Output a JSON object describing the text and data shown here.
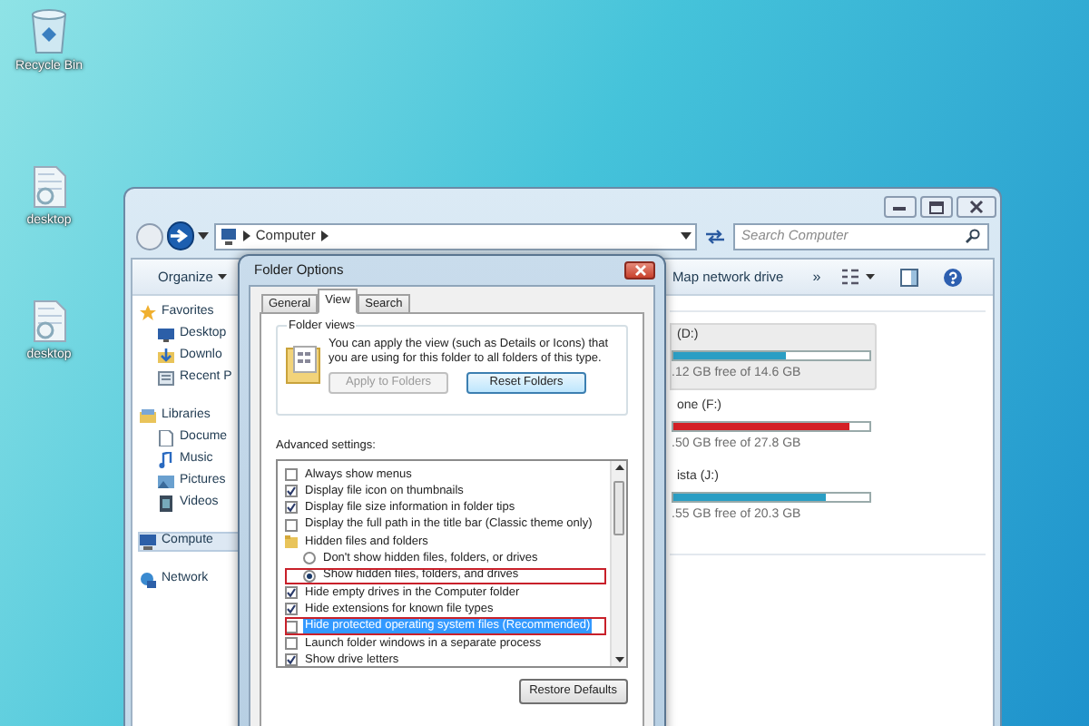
{
  "desktop_icons": [
    {
      "label": "Recycle Bin",
      "kind": "recycle"
    },
    {
      "label": "desktop",
      "kind": "file"
    },
    {
      "label": "desktop",
      "kind": "file"
    }
  ],
  "explorer": {
    "address": "Computer",
    "search": {
      "placeholder": "Search Computer"
    },
    "toolbar": {
      "organize": "Organize",
      "map_drive": "Map network drive",
      "more": "»"
    },
    "nav_pane": [
      {
        "label": "Favorites",
        "kind": "favorites",
        "selected": false,
        "children": [
          {
            "label": "Desktop",
            "kind": "desktop",
            "selected": false
          },
          {
            "label": "Downlo",
            "kind": "downloads",
            "selected": false
          },
          {
            "label": "Recent P",
            "kind": "recent",
            "selected": false
          }
        ]
      },
      {
        "label": "Libraries",
        "kind": "libraries",
        "selected": false,
        "children": [
          {
            "label": "Docume",
            "kind": "documents",
            "selected": false
          },
          {
            "label": "Music",
            "kind": "music",
            "selected": false
          },
          {
            "label": "Pictures",
            "kind": "pictures",
            "selected": false
          },
          {
            "label": "Videos",
            "kind": "videos",
            "selected": false
          }
        ]
      },
      {
        "label": "Compute",
        "kind": "computer",
        "selected": true
      },
      {
        "label": "Network",
        "kind": "network",
        "selected": false
      }
    ],
    "drives": [
      {
        "name": "(D:)",
        "free": ".12 GB free of 14.6 GB",
        "level": 0.57,
        "color": "#2a9ec4",
        "selected": true
      },
      {
        "name": "one (F:)",
        "free": ".50 GB free of 27.8 GB",
        "level": 0.9,
        "color": "#d42026",
        "selected": false
      },
      {
        "name": "ista (J:)",
        "free": ".55 GB free of 20.3 GB",
        "level": 0.78,
        "color": "#2a9ec4",
        "selected": false
      }
    ]
  },
  "dialog": {
    "title": "Folder Options",
    "tabs": [
      {
        "label": "General",
        "selected": false
      },
      {
        "label": "View",
        "selected": true
      },
      {
        "label": "Search",
        "selected": false
      }
    ],
    "folder_views": {
      "legend": "Folder views",
      "text": "You can apply the view (such as Details or Icons) that you are using for this folder to all folders of this type.",
      "buttons": [
        {
          "label": "Apply to Folders",
          "disabled": true
        },
        {
          "label": "Reset Folders",
          "disabled": false
        }
      ]
    },
    "advanced_label": "Advanced settings:",
    "settings": [
      {
        "kind": "checkbox",
        "label": "Always show menus",
        "checked": false,
        "selected": false,
        "annotated": false
      },
      {
        "kind": "checkbox",
        "label": "Display file icon on thumbnails",
        "checked": true,
        "selected": false,
        "annotated": false
      },
      {
        "kind": "checkbox",
        "label": "Display file size information in folder tips",
        "checked": true,
        "selected": false,
        "annotated": false
      },
      {
        "kind": "checkbox",
        "label": "Display the full path in the title bar (Classic theme only)",
        "checked": false,
        "selected": false,
        "annotated": false
      },
      {
        "kind": "folder",
        "label": "Hidden files and folders",
        "selected": false,
        "annotated": false,
        "children": [
          {
            "kind": "radio",
            "label": "Don't show hidden files, folders, or drives",
            "checked": false,
            "selected": false,
            "annotated": false
          },
          {
            "kind": "radio",
            "label": "Show hidden files, folders, and drives",
            "checked": true,
            "selected": false,
            "annotated": true
          }
        ]
      },
      {
        "kind": "checkbox",
        "label": "Hide empty drives in the Computer folder",
        "checked": true,
        "selected": false,
        "annotated": false
      },
      {
        "kind": "checkbox",
        "label": "Hide extensions for known file types",
        "checked": true,
        "selected": false,
        "annotated": false
      },
      {
        "kind": "checkbox",
        "label": "Hide protected operating system files (Recommended)",
        "checked": false,
        "selected": true,
        "annotated": true
      },
      {
        "kind": "checkbox",
        "label": "Launch folder windows in a separate process",
        "checked": false,
        "selected": false,
        "annotated": false
      },
      {
        "kind": "checkbox",
        "label": "Show drive letters",
        "checked": true,
        "selected": false,
        "annotated": false
      }
    ],
    "restore_button": "Restore Defaults"
  }
}
